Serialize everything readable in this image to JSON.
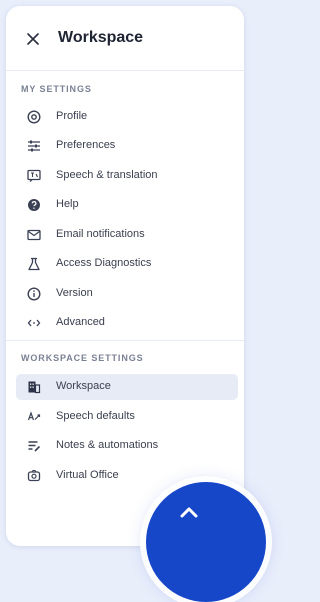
{
  "header": {
    "title": "Workspace",
    "close_icon": "close-icon"
  },
  "sections": {
    "my_settings": {
      "label": "MY SETTINGS",
      "items": [
        {
          "label": "Profile",
          "icon": "at-sign-icon"
        },
        {
          "label": "Preferences",
          "icon": "sliders-icon"
        },
        {
          "label": "Speech & translation",
          "icon": "translate-icon"
        },
        {
          "label": "Help",
          "icon": "help-icon"
        },
        {
          "label": "Email notifications",
          "icon": "mail-icon"
        },
        {
          "label": "Access Diagnostics",
          "icon": "flask-icon"
        },
        {
          "label": "Version",
          "icon": "info-icon"
        },
        {
          "label": "Advanced",
          "icon": "code-icon"
        }
      ]
    },
    "workspace_settings": {
      "label": "WORKSPACE SETTINGS",
      "items": [
        {
          "label": "Workspace",
          "icon": "building-icon",
          "active": true
        },
        {
          "label": "Speech defaults",
          "icon": "speech-defaults-icon"
        },
        {
          "label": "Notes & automations",
          "icon": "notes-icon"
        },
        {
          "label": "Virtual Office",
          "icon": "office-icon"
        }
      ]
    }
  },
  "colors": {
    "accent": "#1747c9",
    "active_bg": "#e7ebf6",
    "page_bg": "#e9eefb"
  }
}
